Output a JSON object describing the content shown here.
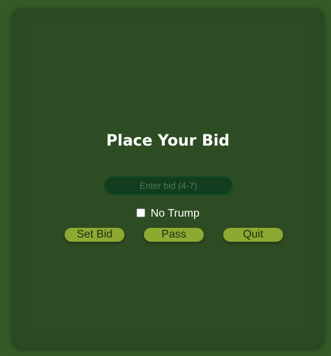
{
  "bid_panel": {
    "title": "Place Your Bid",
    "bid_input": {
      "value": "",
      "placeholder": "Enter bid (4-7)"
    },
    "no_trump": {
      "label": "No Trump",
      "checked": false
    },
    "buttons": {
      "set_bid": "Set Bid",
      "pass": "Pass",
      "quit": "Quit"
    }
  },
  "colors": {
    "background": "#355a28",
    "panel": "#2e4c23",
    "input_fill": "#123d1e",
    "input_border": "#0f4a1e",
    "button": "#8ea932",
    "title_text": "#ffffff"
  }
}
